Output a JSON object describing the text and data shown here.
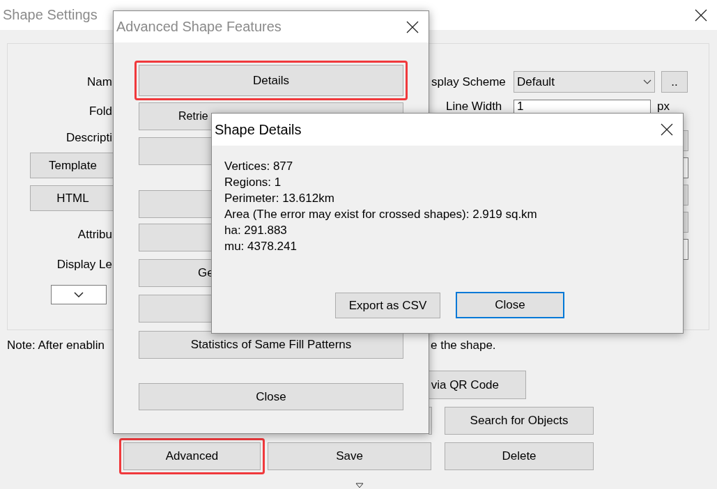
{
  "main_window": {
    "title": "Shape Settings",
    "labels": [
      {
        "text": "Nam"
      },
      {
        "text": "Fold"
      },
      {
        "text": "Descripti"
      },
      {
        "text": "Attribu"
      },
      {
        "text": "Display Le"
      }
    ],
    "left_buttons": [
      "Template",
      "HTML"
    ],
    "display_scheme": {
      "label": "splay Scheme",
      "value": "Default",
      "more": ".."
    },
    "line_width": {
      "label": "Line Width",
      "value": "1",
      "unit": "px"
    },
    "right_edge_controls": [
      {
        "kind": "button"
      },
      {
        "kind": "field"
      },
      {
        "kind": "button"
      },
      {
        "kind": "button"
      },
      {
        "kind": "field"
      }
    ],
    "note": {
      "start": "Note: After enablin",
      "end": "e the shape."
    },
    "bottom_buttons": [
      {
        "label": "via QR Code",
        "highlighted": false
      },
      {
        "label": "Search for Objects",
        "highlighted": false
      },
      {
        "label": "Advanced",
        "highlighted": true
      },
      {
        "label": "Save",
        "highlighted": false
      },
      {
        "label": "Delete",
        "highlighted": false
      }
    ]
  },
  "advanced_window": {
    "title": "Advanced Shape Features",
    "buttons": [
      {
        "label": "Details",
        "highlighted": true
      },
      {
        "label": "Retrie",
        "highlighted": false
      },
      {
        "highlighted": false
      },
      {
        "highlighted": false
      },
      {
        "highlighted": false
      },
      {
        "label": "Ge",
        "highlighted": false
      },
      {
        "highlighted": false
      },
      {
        "label": "Statistics of Same Fill Patterns",
        "highlighted": false
      }
    ],
    "close": "Close"
  },
  "details_window": {
    "title": "Shape Details",
    "lines": [
      "Vertices: 877",
      "Regions: 1",
      "Perimeter: 13.612km",
      "Area (The error may exist for crossed shapes): 2.919 sq.km",
      "ha: 291.883",
      "mu: 4378.241"
    ],
    "buttons": [
      {
        "label": "Export as CSV",
        "default": false
      },
      {
        "label": "Close",
        "default": true
      }
    ]
  }
}
